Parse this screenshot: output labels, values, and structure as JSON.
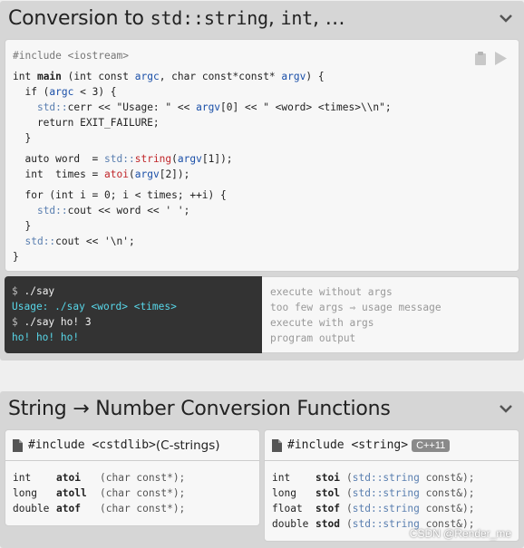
{
  "panel1": {
    "title_text": "Conversion to ",
    "title_std_string": "std::string",
    "title_sep1": ", ",
    "title_int": "int",
    "title_sep2": ", …"
  },
  "code": {
    "include": "#include <iostream>",
    "lines": [
      "int main (int const argc, char const*const* argv) {",
      "  if (argc < 3) {",
      "    std::cerr << \"Usage: \" << argv[0] << \" <word> <times>\\\\n\";",
      "    return EXIT_FAILURE;",
      "  }",
      "  auto word  = std::string(argv[1]);",
      "  int  times = atoi(argv[2]);",
      "  for (int i = 0; i < times; ++i) {",
      "    std::cout << word << ' ';",
      "  }",
      "  std::cout << '\\n';",
      "}"
    ]
  },
  "terminal": {
    "lines": [
      {
        "prompt": "$ ",
        "text": "./say"
      },
      {
        "prompt": "",
        "text": "Usage: ./say <word> <times>"
      },
      {
        "prompt": "$ ",
        "text": "./say ho! 3"
      },
      {
        "prompt": "",
        "text": "ho! ho! ho!"
      }
    ],
    "notes": [
      "execute without args",
      "too few args ⇒ usage message",
      "execute with args",
      "program output"
    ]
  },
  "panel2": {
    "title": "String → Number Conversion Functions"
  },
  "card_cstdlib": {
    "include": "#include <cstdlib>",
    "suffix": " (C-strings)",
    "rows": [
      {
        "type": "int",
        "name": "atoi",
        "sig": "(char const*);"
      },
      {
        "type": "long",
        "name": "atoll",
        "sig": "(char const*);"
      },
      {
        "type": "double",
        "name": "atof",
        "sig": "(char const*);"
      }
    ]
  },
  "card_string": {
    "include": "#include <string>",
    "badge": "C++11",
    "rows": [
      {
        "type": "int",
        "name": "stoi",
        "sig_ns": "std::string",
        "sig_rest": " const&);"
      },
      {
        "type": "long",
        "name": "stol",
        "sig_ns": "std::string",
        "sig_rest": " const&);"
      },
      {
        "type": "float",
        "name": "stof",
        "sig_ns": "std::string",
        "sig_rest": " const&);"
      },
      {
        "type": "double",
        "name": "stod",
        "sig_ns": "std::string",
        "sig_rest": " const&);"
      }
    ]
  },
  "watermark": "CSDN @Render_me",
  "colors": {
    "terminal_bg": "#333333",
    "terminal_accent": "#58d6e8",
    "panel_bg": "#d6d6d6",
    "param": "#1a4fa8",
    "function": "#c0262a"
  }
}
